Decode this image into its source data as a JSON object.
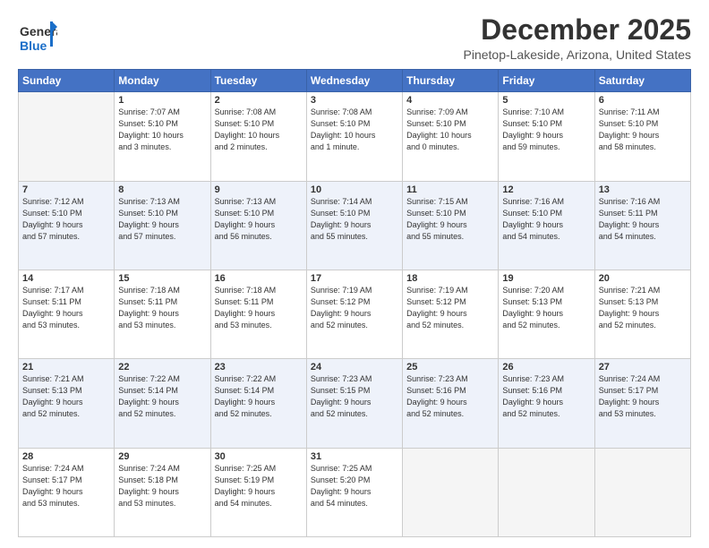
{
  "logo": {
    "line1": "General",
    "line2": "Blue"
  },
  "title": "December 2025",
  "location": "Pinetop-Lakeside, Arizona, United States",
  "weekdays": [
    "Sunday",
    "Monday",
    "Tuesday",
    "Wednesday",
    "Thursday",
    "Friday",
    "Saturday"
  ],
  "weeks": [
    [
      {
        "day": "",
        "info": ""
      },
      {
        "day": "1",
        "info": "Sunrise: 7:07 AM\nSunset: 5:10 PM\nDaylight: 10 hours\nand 3 minutes."
      },
      {
        "day": "2",
        "info": "Sunrise: 7:08 AM\nSunset: 5:10 PM\nDaylight: 10 hours\nand 2 minutes."
      },
      {
        "day": "3",
        "info": "Sunrise: 7:08 AM\nSunset: 5:10 PM\nDaylight: 10 hours\nand 1 minute."
      },
      {
        "day": "4",
        "info": "Sunrise: 7:09 AM\nSunset: 5:10 PM\nDaylight: 10 hours\nand 0 minutes."
      },
      {
        "day": "5",
        "info": "Sunrise: 7:10 AM\nSunset: 5:10 PM\nDaylight: 9 hours\nand 59 minutes."
      },
      {
        "day": "6",
        "info": "Sunrise: 7:11 AM\nSunset: 5:10 PM\nDaylight: 9 hours\nand 58 minutes."
      }
    ],
    [
      {
        "day": "7",
        "info": "Sunrise: 7:12 AM\nSunset: 5:10 PM\nDaylight: 9 hours\nand 57 minutes."
      },
      {
        "day": "8",
        "info": "Sunrise: 7:13 AM\nSunset: 5:10 PM\nDaylight: 9 hours\nand 57 minutes."
      },
      {
        "day": "9",
        "info": "Sunrise: 7:13 AM\nSunset: 5:10 PM\nDaylight: 9 hours\nand 56 minutes."
      },
      {
        "day": "10",
        "info": "Sunrise: 7:14 AM\nSunset: 5:10 PM\nDaylight: 9 hours\nand 55 minutes."
      },
      {
        "day": "11",
        "info": "Sunrise: 7:15 AM\nSunset: 5:10 PM\nDaylight: 9 hours\nand 55 minutes."
      },
      {
        "day": "12",
        "info": "Sunrise: 7:16 AM\nSunset: 5:10 PM\nDaylight: 9 hours\nand 54 minutes."
      },
      {
        "day": "13",
        "info": "Sunrise: 7:16 AM\nSunset: 5:11 PM\nDaylight: 9 hours\nand 54 minutes."
      }
    ],
    [
      {
        "day": "14",
        "info": "Sunrise: 7:17 AM\nSunset: 5:11 PM\nDaylight: 9 hours\nand 53 minutes."
      },
      {
        "day": "15",
        "info": "Sunrise: 7:18 AM\nSunset: 5:11 PM\nDaylight: 9 hours\nand 53 minutes."
      },
      {
        "day": "16",
        "info": "Sunrise: 7:18 AM\nSunset: 5:11 PM\nDaylight: 9 hours\nand 53 minutes."
      },
      {
        "day": "17",
        "info": "Sunrise: 7:19 AM\nSunset: 5:12 PM\nDaylight: 9 hours\nand 52 minutes."
      },
      {
        "day": "18",
        "info": "Sunrise: 7:19 AM\nSunset: 5:12 PM\nDaylight: 9 hours\nand 52 minutes."
      },
      {
        "day": "19",
        "info": "Sunrise: 7:20 AM\nSunset: 5:13 PM\nDaylight: 9 hours\nand 52 minutes."
      },
      {
        "day": "20",
        "info": "Sunrise: 7:21 AM\nSunset: 5:13 PM\nDaylight: 9 hours\nand 52 minutes."
      }
    ],
    [
      {
        "day": "21",
        "info": "Sunrise: 7:21 AM\nSunset: 5:13 PM\nDaylight: 9 hours\nand 52 minutes."
      },
      {
        "day": "22",
        "info": "Sunrise: 7:22 AM\nSunset: 5:14 PM\nDaylight: 9 hours\nand 52 minutes."
      },
      {
        "day": "23",
        "info": "Sunrise: 7:22 AM\nSunset: 5:14 PM\nDaylight: 9 hours\nand 52 minutes."
      },
      {
        "day": "24",
        "info": "Sunrise: 7:23 AM\nSunset: 5:15 PM\nDaylight: 9 hours\nand 52 minutes."
      },
      {
        "day": "25",
        "info": "Sunrise: 7:23 AM\nSunset: 5:16 PM\nDaylight: 9 hours\nand 52 minutes."
      },
      {
        "day": "26",
        "info": "Sunrise: 7:23 AM\nSunset: 5:16 PM\nDaylight: 9 hours\nand 52 minutes."
      },
      {
        "day": "27",
        "info": "Sunrise: 7:24 AM\nSunset: 5:17 PM\nDaylight: 9 hours\nand 53 minutes."
      }
    ],
    [
      {
        "day": "28",
        "info": "Sunrise: 7:24 AM\nSunset: 5:17 PM\nDaylight: 9 hours\nand 53 minutes."
      },
      {
        "day": "29",
        "info": "Sunrise: 7:24 AM\nSunset: 5:18 PM\nDaylight: 9 hours\nand 53 minutes."
      },
      {
        "day": "30",
        "info": "Sunrise: 7:25 AM\nSunset: 5:19 PM\nDaylight: 9 hours\nand 54 minutes."
      },
      {
        "day": "31",
        "info": "Sunrise: 7:25 AM\nSunset: 5:20 PM\nDaylight: 9 hours\nand 54 minutes."
      },
      {
        "day": "",
        "info": ""
      },
      {
        "day": "",
        "info": ""
      },
      {
        "day": "",
        "info": ""
      }
    ]
  ]
}
